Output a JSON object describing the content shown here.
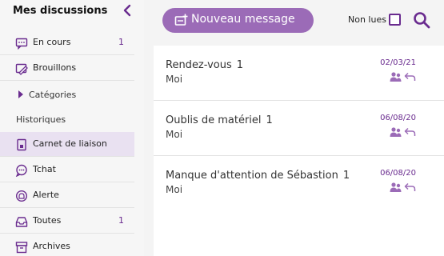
{
  "sidebar": {
    "title": "Mes discussions",
    "items": [
      {
        "label": "En cours",
        "count": "1",
        "icon": "chat-dots-icon"
      },
      {
        "label": "Brouillons",
        "count": "",
        "icon": "draft-edit-icon"
      },
      {
        "label": "Carnet de liaison",
        "count": "",
        "icon": "notebook-icon"
      },
      {
        "label": "Tchat",
        "count": "",
        "icon": "chat-bubbles-icon"
      },
      {
        "label": "Alerte",
        "count": "",
        "icon": "alert-bell-icon"
      },
      {
        "label": "Toutes",
        "count": "1",
        "icon": "inbox-tray-icon"
      },
      {
        "label": "Archives",
        "count": "",
        "icon": "archive-box-icon"
      }
    ],
    "categories_label": "Catégories",
    "history_label": "Historiques"
  },
  "toolbar": {
    "new_message_label": "Nouveau message",
    "unread_label": "Non lues"
  },
  "messages": [
    {
      "subject": "Rendez-vous",
      "count": "1",
      "from": "Moi",
      "date": "02/03/21"
    },
    {
      "subject": "Oublis de matériel",
      "count": "1",
      "from": "Moi",
      "date": "06/08/20"
    },
    {
      "subject": "Manque d'attention de Sébastion",
      "count": "1",
      "from": "Moi",
      "date": "06/08/20"
    }
  ],
  "colors": {
    "accent": "#6a2c8f",
    "button": "#9b6bb7",
    "active_bg": "#e9e1f1"
  }
}
